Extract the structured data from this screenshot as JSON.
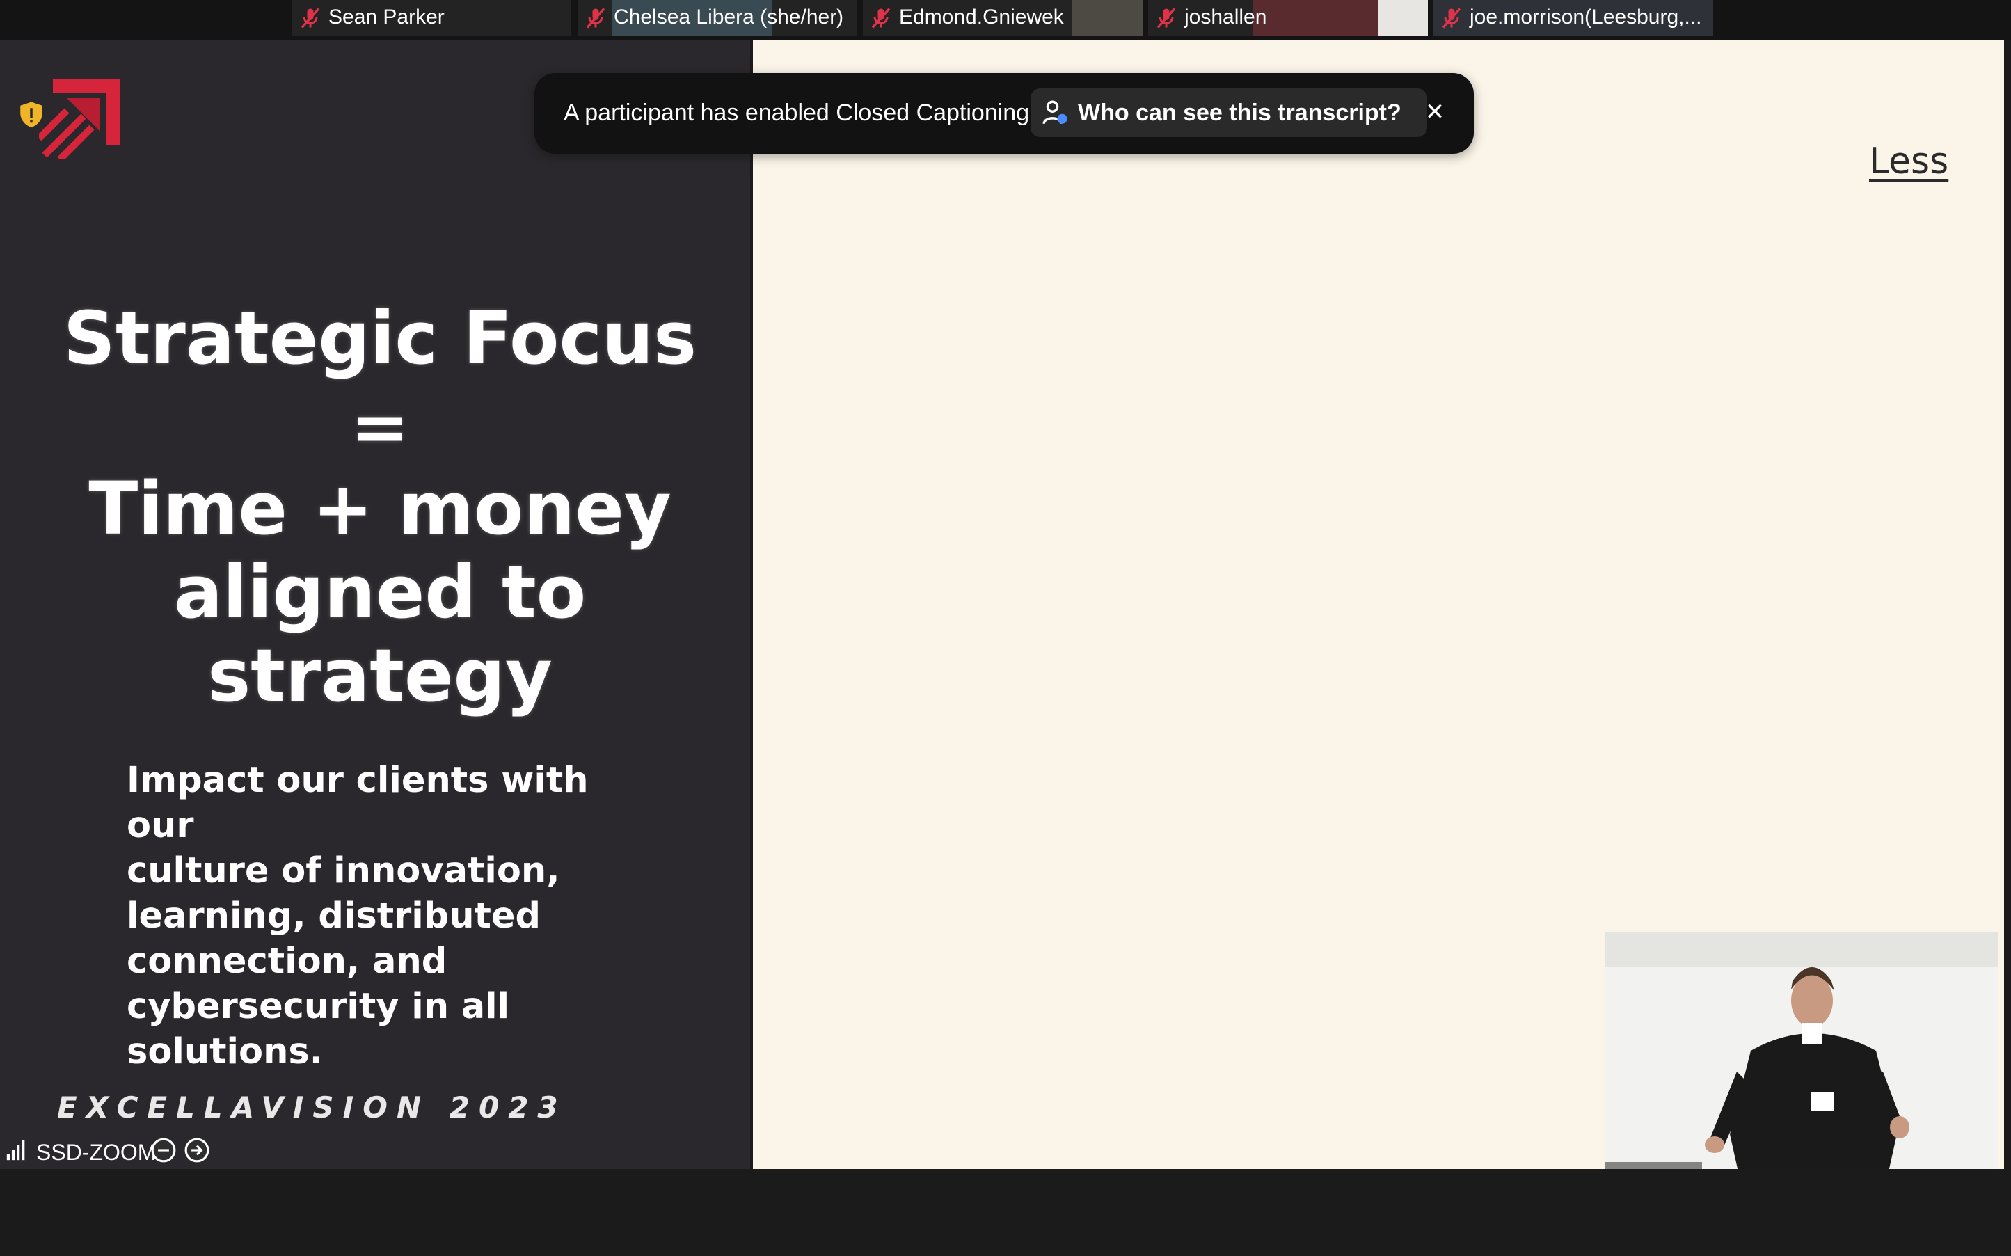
{
  "participants": [
    {
      "name": "Sean Parker"
    },
    {
      "name": "Chelsea Libera (she/her)"
    },
    {
      "name": "Edmond.Gniewek"
    },
    {
      "name": "joshallen"
    },
    {
      "name": "joe.morrison(Leesburg,..."
    }
  ],
  "notification": {
    "message": "A participant has enabled Closed Captioning",
    "button_label": "Who can see this transcript?",
    "close_icon": "close-icon"
  },
  "slide": {
    "title": "Strategic Focus",
    "operator": "=",
    "subtitle_lines": [
      "Time + money",
      "aligned to",
      "strategy"
    ],
    "body_lines": [
      "Impact our clients with our",
      "culture of innovation,",
      "learning, distributed",
      "connection, and",
      "cybersecurity in all",
      "solutions."
    ],
    "footer": "EXCELLAVISION 2023",
    "right_panel_text": "Less"
  },
  "status": {
    "connection_label": "SSD-ZOOM"
  },
  "colors": {
    "brand_red": "#d6253a",
    "slide_bg": "#2a282c",
    "canvas_bg": "#fbf5e9",
    "muted_red": "#e0334a"
  }
}
